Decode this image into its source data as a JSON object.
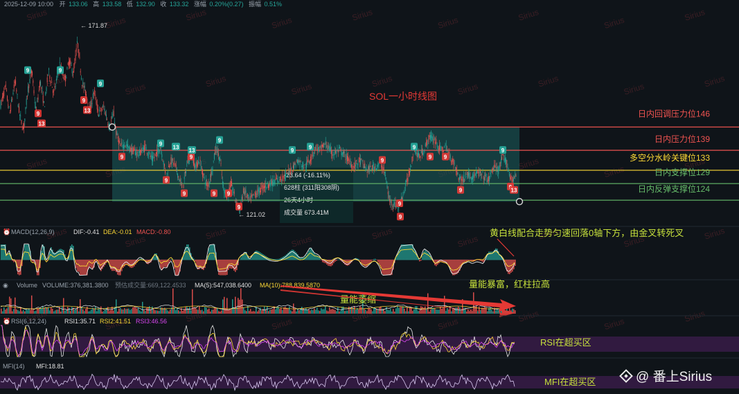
{
  "header": {
    "datetime": "2025-12-09 10:00",
    "open_label": "开",
    "open": "133.06",
    "high_label": "高",
    "high": "133.58",
    "low_label": "低",
    "low": "132.90",
    "close_label": "收",
    "close": "133.32",
    "change_label": "涨幅",
    "change": "0.20%(0.27)",
    "amplitude_label": "振幅",
    "amplitude": "0.51%"
  },
  "watermark": "Sirius",
  "brand": {
    "icon": "binance-square-icon",
    "text": "@ 番上Sirius"
  },
  "colors": {
    "up": "#26a69a",
    "down": "#ef5350",
    "red_line": "#e53935",
    "yellow_line": "#fdd835",
    "green_line": "#43a047",
    "box": "#1f6f70"
  },
  "chart_data": [
    {
      "type": "candlestick",
      "title": "SOL一小时线图",
      "high_marker": "← 171.87",
      "low_marker": "← 121.02",
      "ylim": [
        118,
        180
      ],
      "levels": [
        {
          "label": "日内回调压力位146",
          "value": 146,
          "color": "#ef5350"
        },
        {
          "label": "日内压力位139",
          "value": 139,
          "color": "#ef5350"
        },
        {
          "label": "多空分水岭关键位133",
          "value": 133,
          "color": "#fdd835"
        },
        {
          "label": "日内支撑位129",
          "value": 129,
          "color": "#66bb6a"
        },
        {
          "label": "日内反弹支撑位124",
          "value": 124,
          "color": "#66bb6a"
        }
      ],
      "path": [
        [
          0,
          152
        ],
        [
          8,
          158
        ],
        [
          14,
          150
        ],
        [
          22,
          160
        ],
        [
          28,
          150
        ],
        [
          34,
          145
        ],
        [
          40,
          157
        ],
        [
          46,
          163
        ],
        [
          52,
          150
        ],
        [
          58,
          160
        ],
        [
          64,
          152
        ],
        [
          70,
          163
        ],
        [
          78,
          156
        ],
        [
          86,
          165
        ],
        [
          94,
          160
        ],
        [
          100,
          166
        ],
        [
          106,
          162
        ],
        [
          112,
          171.8
        ],
        [
          118,
          160
        ],
        [
          124,
          156
        ],
        [
          130,
          151
        ],
        [
          136,
          157
        ],
        [
          142,
          150
        ],
        [
          150,
          152
        ],
        [
          158,
          146
        ],
        [
          164,
          150
        ],
        [
          168,
          144
        ],
        [
          174,
          140
        ],
        [
          180,
          141
        ],
        [
          190,
          139
        ],
        [
          200,
          138
        ],
        [
          210,
          140
        ],
        [
          220,
          136
        ],
        [
          226,
          138
        ],
        [
          232,
          140
        ],
        [
          240,
          131
        ],
        [
          246,
          136
        ],
        [
          252,
          135
        ],
        [
          258,
          131
        ],
        [
          264,
          127
        ],
        [
          270,
          135
        ],
        [
          276,
          138
        ],
        [
          282,
          134
        ],
        [
          288,
          136
        ],
        [
          294,
          131
        ],
        [
          300,
          128
        ],
        [
          306,
          133
        ],
        [
          312,
          140
        ],
        [
          318,
          136
        ],
        [
          322,
          128
        ],
        [
          328,
          125
        ],
        [
          334,
          129
        ],
        [
          340,
          124
        ],
        [
          346,
          121
        ],
        [
          352,
          127
        ],
        [
          360,
          124
        ],
        [
          370,
          126
        ],
        [
          380,
          128
        ],
        [
          390,
          129
        ],
        [
          400,
          130
        ],
        [
          410,
          131
        ],
        [
          420,
          133
        ],
        [
          430,
          136
        ],
        [
          440,
          134
        ],
        [
          450,
          137
        ],
        [
          456,
          140
        ],
        [
          462,
          139
        ],
        [
          470,
          141
        ],
        [
          480,
          138
        ],
        [
          490,
          139
        ],
        [
          500,
          137
        ],
        [
          510,
          134
        ],
        [
          520,
          136
        ],
        [
          530,
          133
        ],
        [
          540,
          134
        ],
        [
          550,
          135
        ],
        [
          556,
          132
        ],
        [
          562,
          124
        ],
        [
          568,
          123
        ],
        [
          576,
          122
        ],
        [
          584,
          127
        ],
        [
          592,
          133
        ],
        [
          598,
          140
        ],
        [
          604,
          137
        ],
        [
          612,
          139
        ],
        [
          620,
          143
        ],
        [
          628,
          142
        ],
        [
          636,
          139
        ],
        [
          644,
          140
        ],
        [
          650,
          137
        ],
        [
          656,
          135
        ],
        [
          662,
          131
        ],
        [
          668,
          130
        ],
        [
          674,
          132
        ],
        [
          680,
          131
        ],
        [
          690,
          132
        ],
        [
          700,
          131
        ],
        [
          706,
          130
        ],
        [
          712,
          134
        ],
        [
          720,
          133
        ],
        [
          726,
          137
        ],
        [
          732,
          135
        ],
        [
          738,
          130
        ],
        [
          744,
          131
        ]
      ],
      "td_markers": [
        {
          "label": "9",
          "x": 40,
          "y": 163,
          "kind": "up"
        },
        {
          "label": "9",
          "x": 87,
          "y": 163,
          "kind": "up"
        },
        {
          "label": "9",
          "x": 55,
          "y": 150,
          "kind": "down"
        },
        {
          "label": "13",
          "x": 60,
          "y": 147,
          "kind": "down"
        },
        {
          "label": "9",
          "x": 121,
          "y": 154,
          "kind": "down"
        },
        {
          "label": "13",
          "x": 126,
          "y": 151,
          "kind": "down"
        },
        {
          "label": "9",
          "x": 145,
          "y": 159,
          "kind": "up"
        },
        {
          "label": "9",
          "x": 176,
          "y": 137,
          "kind": "down"
        },
        {
          "label": "9",
          "x": 232,
          "y": 141,
          "kind": "up"
        },
        {
          "label": "13",
          "x": 254,
          "y": 140,
          "kind": "up"
        },
        {
          "label": "9",
          "x": 240,
          "y": 130,
          "kind": "down"
        },
        {
          "label": "9",
          "x": 276,
          "y": 137,
          "kind": "down"
        },
        {
          "label": "13",
          "x": 277,
          "y": 139,
          "kind": "up"
        },
        {
          "label": "9",
          "x": 266,
          "y": 126,
          "kind": "down"
        },
        {
          "label": "9",
          "x": 317,
          "y": 142,
          "kind": "up"
        },
        {
          "label": "9",
          "x": 309,
          "y": 126,
          "kind": "down"
        },
        {
          "label": "9",
          "x": 330,
          "y": 126,
          "kind": "down"
        },
        {
          "label": "9",
          "x": 345,
          "y": 122,
          "kind": "down"
        },
        {
          "label": "9",
          "x": 422,
          "y": 139,
          "kind": "up"
        },
        {
          "label": "9",
          "x": 448,
          "y": 140,
          "kind": "up"
        },
        {
          "label": "9",
          "x": 552,
          "y": 136,
          "kind": "down"
        },
        {
          "label": "9",
          "x": 577,
          "y": 123,
          "kind": "down"
        },
        {
          "label": "9",
          "x": 578,
          "y": 119,
          "kind": "down"
        },
        {
          "label": "9",
          "x": 598,
          "y": 140,
          "kind": "up"
        },
        {
          "label": "9",
          "x": 621,
          "y": 137,
          "kind": "down"
        },
        {
          "label": "9",
          "x": 643,
          "y": 137,
          "kind": "down"
        },
        {
          "label": "9",
          "x": 665,
          "y": 127,
          "kind": "down"
        },
        {
          "label": "9",
          "x": 726,
          "y": 139,
          "kind": "up"
        },
        {
          "label": "9",
          "x": 737,
          "y": 128,
          "kind": "down"
        },
        {
          "label": "13",
          "x": 742,
          "y": 127,
          "kind": "down"
        }
      ],
      "measure": {
        "change": "-23.64 (-16.11%)",
        "bars": "628柱 (311阳308阴)",
        "duration": "26天4小时",
        "volume": "成交量 673.41M"
      }
    },
    {
      "type": "macd",
      "params": "MACD(12,26,9)",
      "dif": "DIF:-0.41",
      "dea": "DEA:-0.01",
      "macd": "MACD:-0.80",
      "annotation": "黄白线配合走势匀速回落0轴下方，由金叉转死叉"
    },
    {
      "type": "volume",
      "label": "Volume",
      "volume": "VOLUME:376,381.3800",
      "estimated": "预估成交量:669,122.4533",
      "ma5": "MA(5):547,038.6400",
      "ma10": "MA(10):788,839.5870",
      "annotation_left": "量能萎缩",
      "annotation_right": "量能暴富，红柱拉高"
    },
    {
      "type": "rsi",
      "params": "RSI(6,12,24)",
      "rsi1": "RSI1:35.71",
      "rsi2": "RSI2:41.51",
      "rsi3": "RSI3:46.56",
      "annotation": "RSI在超买区"
    },
    {
      "type": "mfi",
      "params": "MFI(14)",
      "mfi": "MFI:18.81",
      "annotation": "MFI在超买区"
    }
  ]
}
